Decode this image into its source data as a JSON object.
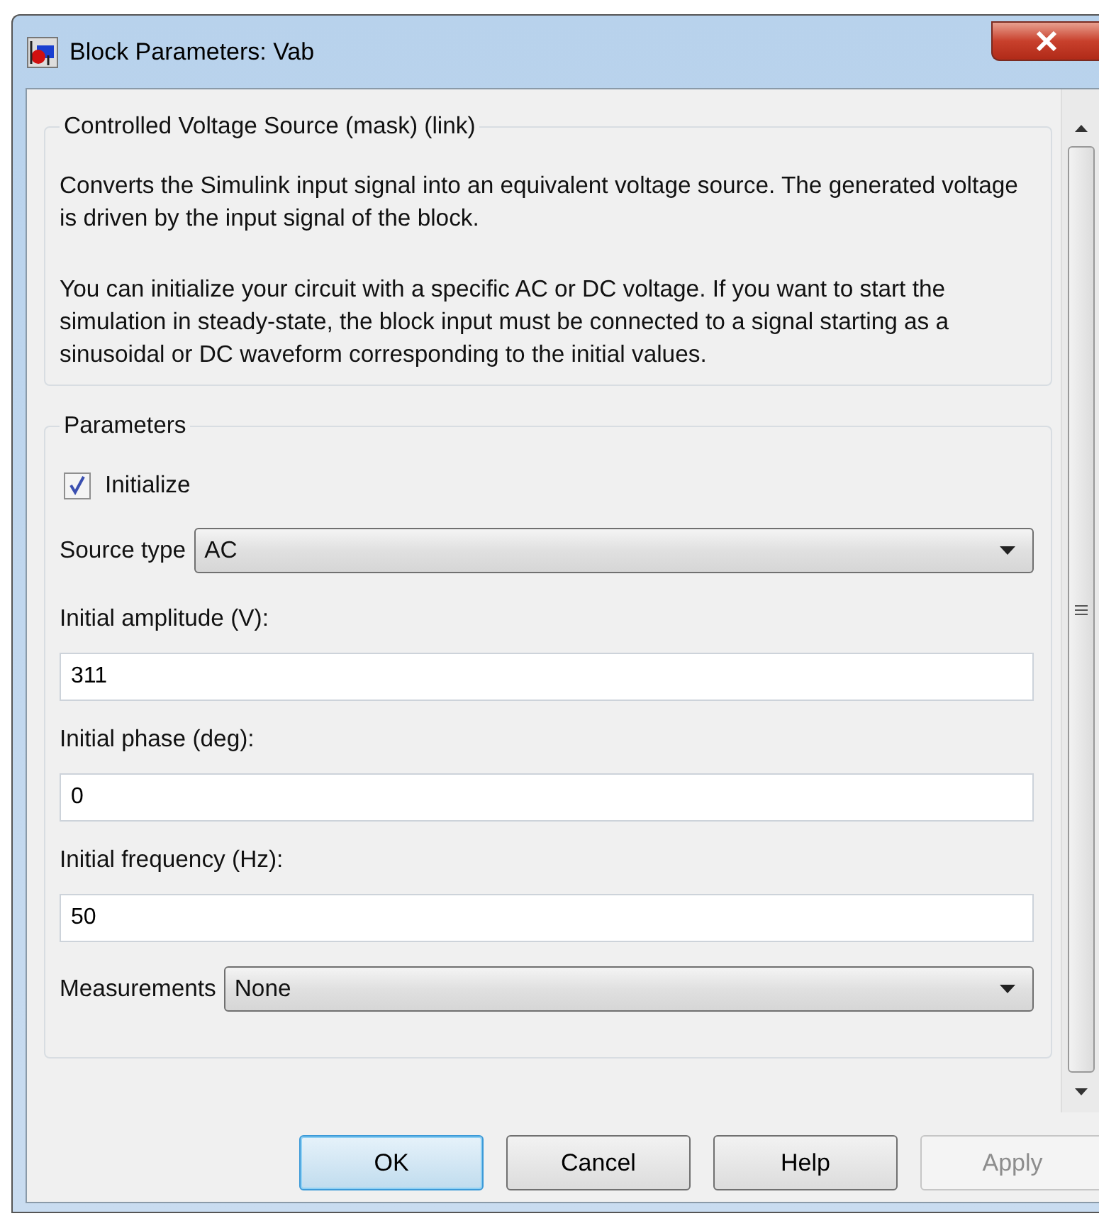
{
  "window": {
    "title": "Block Parameters: Vab"
  },
  "description": {
    "title": "Controlled Voltage Source (mask) (link)",
    "paragraphs": [
      "Converts the Simulink input signal into an equivalent voltage source. The generated voltage is driven by the input signal of the block.",
      "You can initialize your circuit with a specific AC or DC voltage. If you want to start the simulation in steady-state, the block input must be connected to a signal starting as a sinusoidal or DC waveform corresponding to the initial values."
    ]
  },
  "parameters": {
    "title": "Parameters",
    "fields": [
      {
        "kind": "checkbox",
        "label": "Initialize",
        "checked": true
      },
      {
        "kind": "dropdown",
        "label": "Source type",
        "value": "AC"
      },
      {
        "kind": "text",
        "label": "Initial amplitude (V):",
        "value": "311"
      },
      {
        "kind": "text",
        "label": "Initial phase (deg):",
        "value": "0"
      },
      {
        "kind": "text",
        "label": "Initial frequency (Hz):",
        "value": "50"
      },
      {
        "kind": "dropdown",
        "label": "Measurements",
        "value": "None"
      }
    ]
  },
  "buttons": [
    {
      "label": "OK",
      "default": true,
      "disabled": false
    },
    {
      "label": "Cancel",
      "default": false,
      "disabled": false
    },
    {
      "label": "Help",
      "default": false,
      "disabled": false
    },
    {
      "label": "Apply",
      "default": false,
      "disabled": true
    }
  ]
}
